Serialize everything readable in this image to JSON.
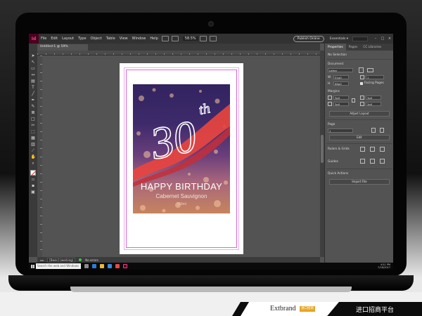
{
  "menubar": {
    "logo": "Id",
    "items": [
      "File",
      "Edit",
      "Layout",
      "Type",
      "Object",
      "Table",
      "View",
      "Window",
      "Help"
    ],
    "zoom": "58.5%",
    "publish_label": "Publish Online",
    "workspace_label": "Essentials ▾"
  },
  "document": {
    "tab_label": "Untitled-1 @ 59%",
    "label": {
      "number": "30",
      "suffix": "th",
      "headline": "HAPPY BIRTHDAY",
      "wine": "Cabernet Sauvignon",
      "volume": "750ml"
    }
  },
  "statusbar": {
    "page_box": "[Basic] (working)",
    "errors": "No errors"
  },
  "panel": {
    "tabs": [
      "Properties",
      "Pages",
      "CC Libraries"
    ],
    "selection": "No Selection",
    "document_heading": "Document",
    "preset": "Letter",
    "width": "51p0",
    "height": "66p0",
    "pages_count": "1",
    "facing_pages": "Facing Pages",
    "margins_heading": "Margins",
    "margin_top": "3p0",
    "margin_bottom": "3p0",
    "margin_left": "3p0",
    "margin_right": "3p0",
    "adjust_layout": "Adjust Layout",
    "page_heading": "Page",
    "page_value": "1",
    "edit_label": "Edit",
    "rulers_grids": "Rulers & Grids",
    "guides": "Guides",
    "quick_actions": "Quick Actions",
    "import_file": "Import File"
  },
  "taskbar": {
    "search_placeholder": "Search the web and Windows",
    "time": "4:51 PM",
    "date": "7/18/2017"
  },
  "brand": {
    "logo": "Extbrand",
    "badge": "进口招商",
    "text": "进口招商平台"
  }
}
